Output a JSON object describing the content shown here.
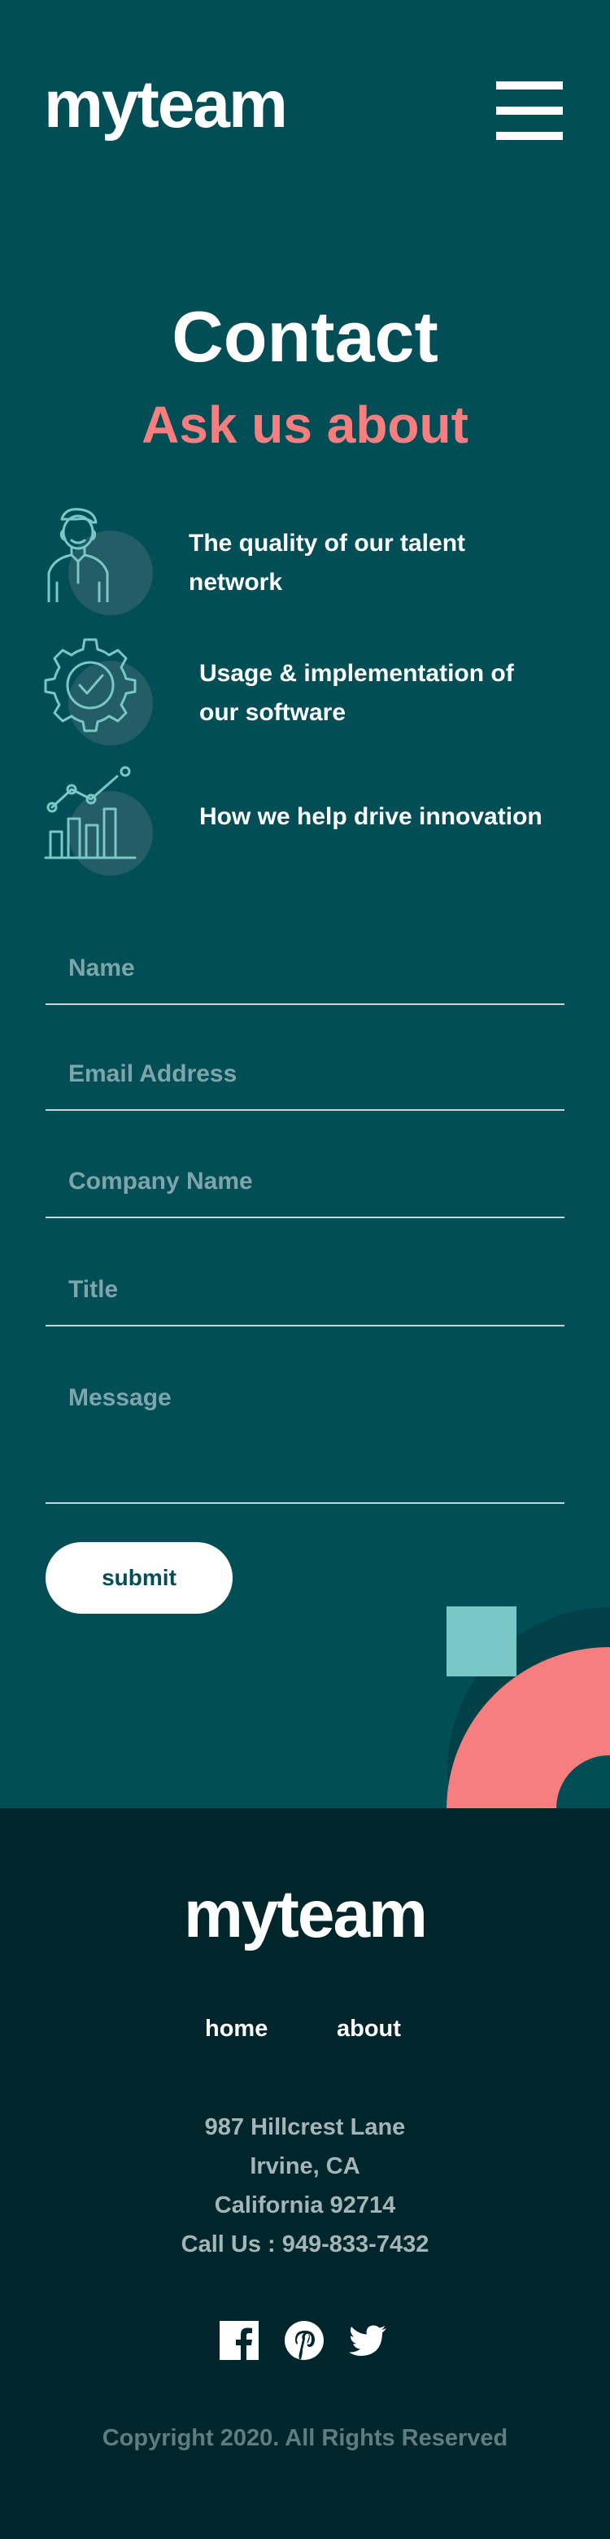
{
  "header": {
    "logo": "myteam",
    "menu_icon": "hamburger-menu-icon"
  },
  "contact": {
    "title": "Contact",
    "subtitle": "Ask us about",
    "topics": [
      {
        "icon": "person-icon",
        "text": "The quality of our talent network"
      },
      {
        "icon": "gear-check-icon",
        "text": "Usage & implementation of our software"
      },
      {
        "icon": "chart-icon",
        "text": "How we help drive innovation"
      }
    ]
  },
  "form": {
    "name_placeholder": "Name",
    "email_placeholder": "Email Address",
    "company_placeholder": "Company Name",
    "title_placeholder": "Title",
    "message_placeholder": "Message",
    "submit_label": "submit"
  },
  "footer": {
    "logo": "myteam",
    "nav": [
      "home",
      "about"
    ],
    "address": [
      "987 Hillcrest Lane",
      "Irvine, CA",
      "California 92714",
      "Call Us : 949-833-7432"
    ],
    "social_icons": [
      "facebook-icon",
      "pinterest-icon",
      "twitter-icon"
    ],
    "copyright": "Copyright 2020. All Rights Reserved"
  },
  "colors": {
    "background": "#014e56",
    "footer_background": "#00252a",
    "accent_coral": "#f67e7e",
    "accent_teal": "#79c8c7",
    "text": "#ffffff"
  }
}
